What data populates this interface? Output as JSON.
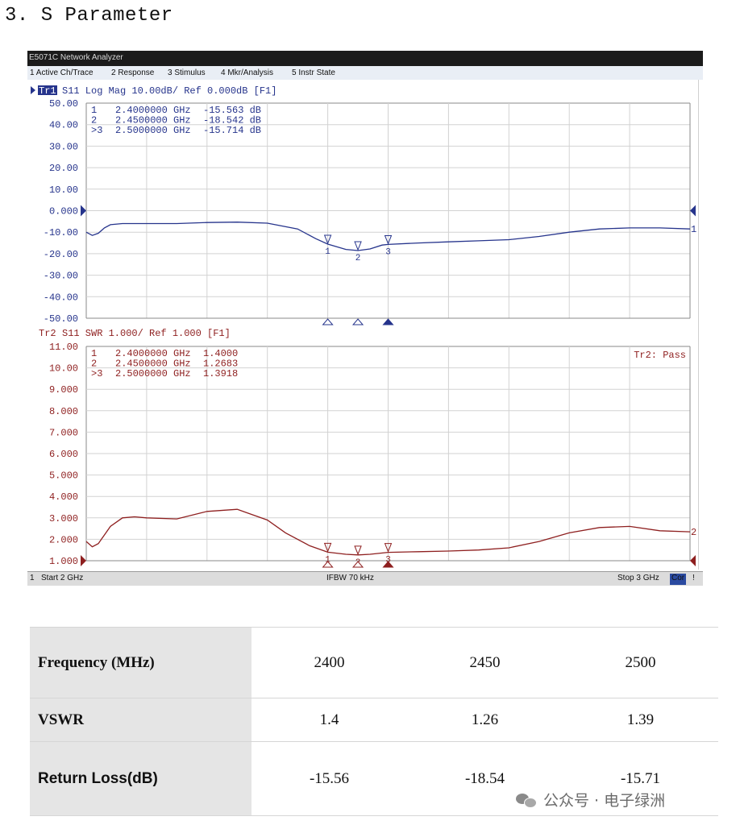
{
  "heading": "3. S Parameter",
  "analyzer": {
    "window_title": "E5071C Network Analyzer",
    "menu": [
      "1 Active Ch/Trace",
      "2 Response",
      "3 Stimulus",
      "4 Mkr/Analysis",
      "5 Instr State"
    ],
    "status": {
      "channel": "1",
      "start": "Start 2 GHz",
      "ifbw": "IFBW 70 kHz",
      "stop": "Stop 3 GHz",
      "cor": "Cor",
      "excl": "!"
    }
  },
  "chart_data": [
    {
      "type": "line",
      "trace_tag": "Tr1",
      "header": "S11 Log Mag 10.00dB/ Ref 0.000dB [F1]",
      "color": "#26348c",
      "xlim": [
        2.0,
        3.0
      ],
      "ylim": [
        -50,
        50
      ],
      "yticks": [
        "50.00",
        "40.00",
        "30.00",
        "20.00",
        "10.00",
        "0.000",
        "-10.00",
        "-20.00",
        "-30.00",
        "-40.00",
        "-50.00"
      ],
      "ref_label": "0.000",
      "ref_value": 0,
      "end_label": "1",
      "grid": true,
      "x": [
        2.0,
        2.01,
        2.02,
        2.03,
        2.04,
        2.06,
        2.1,
        2.15,
        2.2,
        2.25,
        2.3,
        2.35,
        2.38,
        2.4,
        2.43,
        2.45,
        2.47,
        2.49,
        2.5,
        2.55,
        2.6,
        2.65,
        2.7,
        2.75,
        2.8,
        2.85,
        2.9,
        2.95,
        3.0
      ],
      "y": [
        -10.0,
        -11.5,
        -10.5,
        -8.0,
        -6.5,
        -6.0,
        -6.0,
        -6.0,
        -5.5,
        -5.3,
        -5.8,
        -8.5,
        -13.0,
        -15.56,
        -18.0,
        -18.54,
        -17.8,
        -16.0,
        -15.71,
        -15.0,
        -14.5,
        -14.0,
        -13.5,
        -12.0,
        -10.0,
        -8.5,
        -8.0,
        -8.0,
        -8.5
      ],
      "markers": [
        {
          "id": "1",
          "label": "1",
          "freq": "2.4000000 GHz",
          "value": "-15.563 dB",
          "x": 2.4,
          "y": -15.563
        },
        {
          "id": "2",
          "label": "2",
          "freq": "2.4500000 GHz",
          "value": "-18.542 dB",
          "x": 2.45,
          "y": -18.542
        },
        {
          "id": "3",
          "label": ">3",
          "freq": "2.5000000 GHz",
          "value": "-15.714 dB",
          "x": 2.5,
          "y": -15.714
        }
      ]
    },
    {
      "type": "line",
      "trace_tag": "Tr2",
      "header": "S11 SWR 1.000/ Ref 1.000 [F1]",
      "color": "#8e1f1f",
      "xlim": [
        2.0,
        3.0
      ],
      "ylim": [
        1,
        11
      ],
      "yticks": [
        "11.00",
        "10.00",
        "9.000",
        "8.000",
        "7.000",
        "6.000",
        "5.000",
        "4.000",
        "3.000",
        "2.000",
        "1.000"
      ],
      "ref_label": "1.000",
      "ref_value": 1,
      "end_label": "2",
      "pass_label": "Tr2: Pass",
      "grid": true,
      "x": [
        2.0,
        2.01,
        2.02,
        2.04,
        2.06,
        2.08,
        2.1,
        2.15,
        2.2,
        2.25,
        2.3,
        2.33,
        2.37,
        2.4,
        2.43,
        2.45,
        2.47,
        2.5,
        2.55,
        2.6,
        2.65,
        2.7,
        2.75,
        2.8,
        2.85,
        2.9,
        2.95,
        3.0
      ],
      "y": [
        1.9,
        1.65,
        1.8,
        2.6,
        3.0,
        3.05,
        3.0,
        2.95,
        3.3,
        3.4,
        2.9,
        2.3,
        1.7,
        1.4,
        1.3,
        1.27,
        1.3,
        1.39,
        1.42,
        1.45,
        1.5,
        1.6,
        1.9,
        2.3,
        2.55,
        2.6,
        2.4,
        2.35
      ],
      "markers": [
        {
          "id": "1",
          "label": "1",
          "freq": "2.4000000 GHz",
          "value": "1.4000",
          "x": 2.4,
          "y": 1.4
        },
        {
          "id": "2",
          "label": "2",
          "freq": "2.4500000 GHz",
          "value": "1.2683",
          "x": 2.45,
          "y": 1.2683
        },
        {
          "id": "3",
          "label": ">3",
          "freq": "2.5000000 GHz",
          "value": "1.3918",
          "x": 2.5,
          "y": 1.3918
        }
      ]
    }
  ],
  "table": {
    "rows": [
      {
        "header": "Frequency (MHz)",
        "cells": [
          "2400",
          "2450",
          "2500"
        ]
      },
      {
        "header": "VSWR",
        "cells": [
          "1.4",
          "1.26",
          "1.39"
        ]
      },
      {
        "header": "Return Loss(dB)",
        "cells": [
          "-15.56",
          "-18.54",
          "-15.71"
        ]
      }
    ]
  },
  "watermark": "公众号 · 电子绿洲"
}
